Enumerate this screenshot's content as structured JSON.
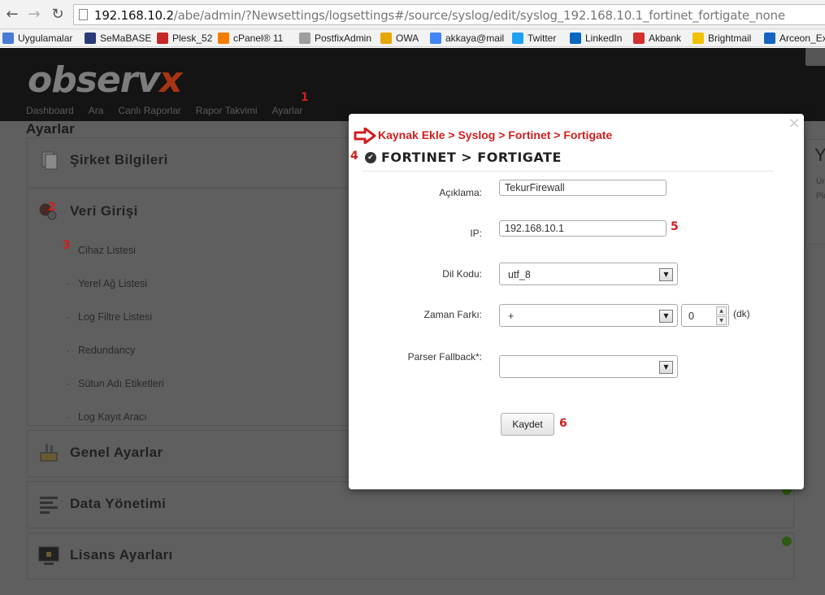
{
  "browser": {
    "url_host": "192.168.10.2",
    "url_path": "/abe/admin/?Newsettings/logsettings#/source/syslog/edit/syslog_192.168.10.1_fortinet_fortigate_none",
    "bookmarks": [
      {
        "label": "Uygulamalar",
        "icon": "apps-grid-icon",
        "color": "#4a7bd6"
      },
      {
        "label": "SeMaBASE",
        "icon": "semabase-icon",
        "color": "#2b3a78"
      },
      {
        "label": "Plesk_52",
        "icon": "plesk-icon",
        "color": "#c62828"
      },
      {
        "label": "cPanel® 11",
        "icon": "cpanel-icon",
        "color": "#f57c00"
      },
      {
        "label": "PostfixAdmin",
        "icon": "page-icon",
        "color": "#9e9e9e"
      },
      {
        "label": "OWA",
        "icon": "owa-icon",
        "color": "#e6a700"
      },
      {
        "label": "akkaya@mail",
        "icon": "google-icon",
        "color": "#4285f4"
      },
      {
        "label": "Twitter",
        "icon": "twitter-icon",
        "color": "#1da1f2"
      },
      {
        "label": "LinkedIn",
        "icon": "linkedin-icon",
        "color": "#0a66c2"
      },
      {
        "label": "Akbank",
        "icon": "akbank-icon",
        "color": "#d32f2f"
      },
      {
        "label": "Brightmail",
        "icon": "brightmail-icon",
        "color": "#f2c200"
      },
      {
        "label": "Arceon_Ex",
        "icon": "outlook-icon",
        "color": "#1565c0"
      }
    ]
  },
  "app": {
    "logo_main": "observ",
    "logo_x": "x",
    "nav": [
      "Dashboard",
      "Ara",
      "Canlı Raporlar",
      "Rapor Takvimi",
      "Ayarlar"
    ],
    "page_title": "Ayarlar",
    "panels": {
      "sirket": "Şirket Bilgileri",
      "veri": "Veri Girişi",
      "genel": "Genel Ayarlar",
      "data": "Data Yönetimi",
      "lisans": "Lisans Ayarları"
    },
    "veri_items": [
      "Cihaz Listesi",
      "Yerel Ağ Listesi",
      "Log Filtre Listesi",
      "Redundancy",
      "Sütun Adı Etiketleri",
      "Log Kayıt Aracı"
    ],
    "right_stub_letter": "Y",
    "right_stub_lines": [
      "Ür",
      "Pla"
    ]
  },
  "annotations": {
    "a1": "1",
    "a2": "2",
    "a3": "3",
    "a4": "4",
    "a5": "5",
    "a6": "6"
  },
  "modal": {
    "breadcrumb": "Kaynak Ekle > Syslog > Fortinet > Fortigate",
    "title": "FORTINET > FORTIGATE",
    "fields": {
      "aciklama_label": "Açıklama:",
      "aciklama_value": "TekurFirewall",
      "ip_label": "IP:",
      "ip_value": "192.168.10.1",
      "dil_label": "Dil Kodu:",
      "dil_value": "utf_8",
      "zaman_label": "Zaman Farkı:",
      "zaman_sign": "+",
      "zaman_value": "0",
      "zaman_unit": "(dk)",
      "parser_label": "Parser Fallback*:",
      "parser_value": ""
    },
    "save_label": "Kaydet"
  },
  "colors": {
    "annotation": "#d21e1e",
    "accent": "#a83414",
    "ok": "#2d5a14"
  }
}
